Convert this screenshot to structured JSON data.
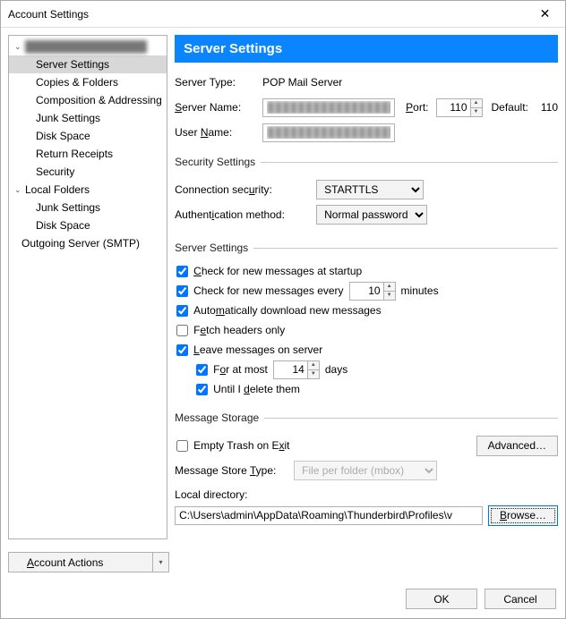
{
  "window": {
    "title": "Account Settings"
  },
  "sidebar": {
    "account_label_redacted": "████████████████",
    "items": [
      "Server Settings",
      "Copies & Folders",
      "Composition & Addressing",
      "Junk Settings",
      "Disk Space",
      "Return Receipts",
      "Security"
    ],
    "local_folders_label": "Local Folders",
    "local_children": [
      "Junk Settings",
      "Disk Space"
    ],
    "outgoing_label": "Outgoing Server (SMTP)",
    "account_actions_label": "Account Actions"
  },
  "main": {
    "banner": "Server Settings",
    "server_type_label": "Server Type:",
    "server_type_value": "POP Mail Server",
    "server_name_label": "Server Name:",
    "server_name_value": "██████████████████",
    "port_label": "Port:",
    "port_value": "110",
    "default_label": "Default:",
    "default_value": "110",
    "user_name_label": "User Name:",
    "user_name_value": "██████████████████",
    "security_legend": "Security Settings",
    "conn_sec_label": "Connection security:",
    "conn_sec_value": "STARTTLS",
    "auth_method_label": "Authentication method:",
    "auth_method_value": "Normal password",
    "server_settings_legend": "Server Settings",
    "chk_startup": "Check for new messages at startup",
    "chk_every_prefix": "Check for new messages every",
    "chk_every_value": "10",
    "chk_every_suffix": "minutes",
    "chk_auto_dl": "Automatically download new messages",
    "chk_headers": "Fetch headers only",
    "chk_leave": "Leave messages on server",
    "chk_atmost_prefix": "For at most",
    "chk_atmost_value": "14",
    "chk_atmost_suffix": "days",
    "chk_until_delete": "Until I delete them",
    "storage_legend": "Message Storage",
    "chk_empty_trash": "Empty Trash on Exit",
    "advanced_btn": "Advanced…",
    "store_type_label": "Message Store Type:",
    "store_type_value": "File per folder (mbox)",
    "local_dir_label": "Local directory:",
    "local_dir_value": "C:\\Users\\admin\\AppData\\Roaming\\Thunderbird\\Profiles\\v",
    "browse_btn": "Browse…"
  },
  "footer": {
    "ok": "OK",
    "cancel": "Cancel"
  }
}
